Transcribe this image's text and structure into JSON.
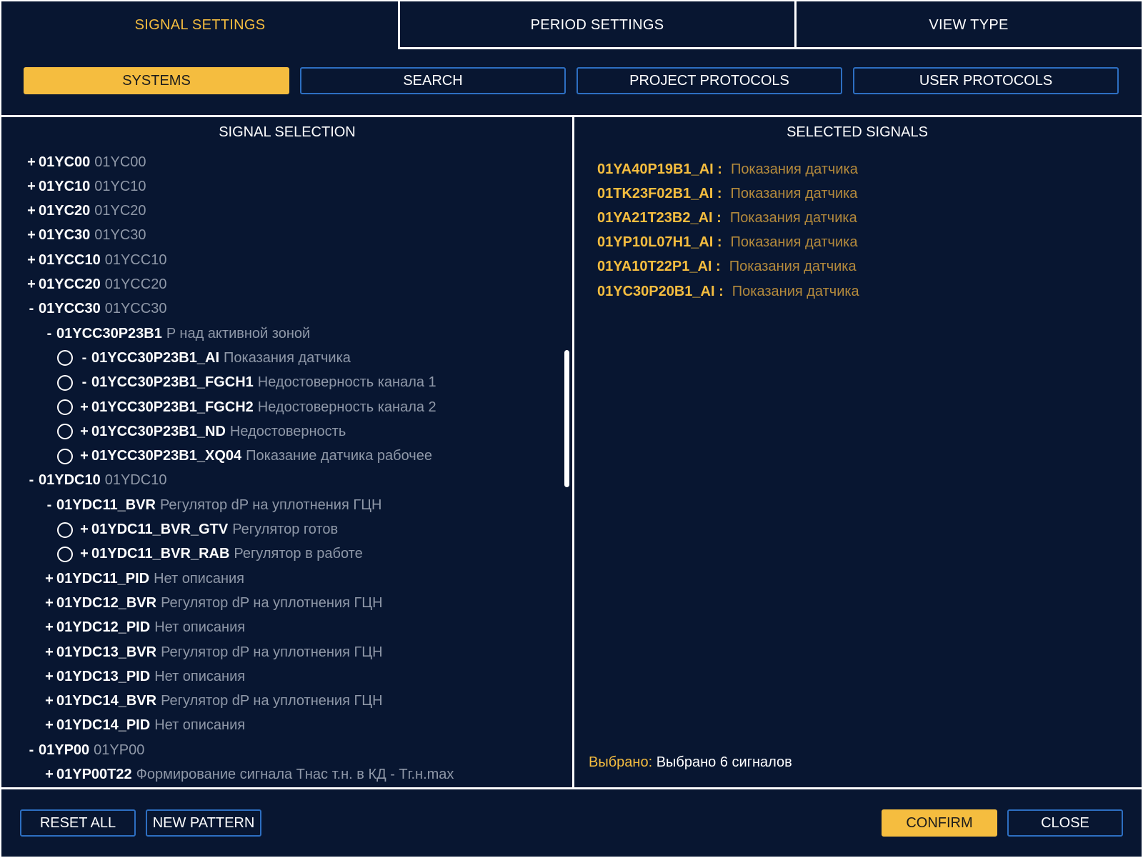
{
  "tabs": [
    {
      "label": "SIGNAL SETTINGS",
      "active": true
    },
    {
      "label": "PERIOD SETTINGS",
      "active": false
    },
    {
      "label": "VIEW TYPE",
      "active": false
    }
  ],
  "subtabs": [
    {
      "label": "SYSTEMS",
      "active": true
    },
    {
      "label": "SEARCH",
      "active": false
    },
    {
      "label": "PROJECT PROTOCOLS",
      "active": false
    },
    {
      "label": "USER PROTOCOLS",
      "active": false
    }
  ],
  "left_panel": {
    "title": "SIGNAL SELECTION",
    "tree": [
      {
        "level": 0,
        "toggle": "+",
        "radio": false,
        "code": "01YC00",
        "desc": "01YC00"
      },
      {
        "level": 0,
        "toggle": "+",
        "radio": false,
        "code": "01YC10",
        "desc": "01YC10"
      },
      {
        "level": 0,
        "toggle": "+",
        "radio": false,
        "code": "01YC20",
        "desc": "01YC20"
      },
      {
        "level": 0,
        "toggle": "+",
        "radio": false,
        "code": "01YC30",
        "desc": "01YC30"
      },
      {
        "level": 0,
        "toggle": "+",
        "radio": false,
        "code": "01YCC10",
        "desc": "01YCC10"
      },
      {
        "level": 0,
        "toggle": "+",
        "radio": false,
        "code": "01YCC20",
        "desc": "01YCC20"
      },
      {
        "level": 0,
        "toggle": "-",
        "radio": false,
        "code": "01YCC30",
        "desc": "01YCC30"
      },
      {
        "level": 1,
        "toggle": "-",
        "radio": false,
        "code": "01YCC30P23B1",
        "desc": "P над активной зоной"
      },
      {
        "level": 2,
        "toggle": "-",
        "radio": true,
        "code": "01YCC30P23B1_AI",
        "desc": "Показания датчика"
      },
      {
        "level": 2,
        "toggle": "-",
        "radio": true,
        "code": "01YCC30P23B1_FGCH1",
        "desc": "Недостоверность канала 1"
      },
      {
        "level": 2,
        "toggle": "+",
        "radio": true,
        "code": "01YCC30P23B1_FGCH2",
        "desc": "Недостоверность канала 2"
      },
      {
        "level": 2,
        "toggle": "+",
        "radio": true,
        "code": "01YCC30P23B1_ND",
        "desc": "Недостоверность"
      },
      {
        "level": 2,
        "toggle": "+",
        "radio": true,
        "code": "01YCC30P23B1_XQ04",
        "desc": "Показание датчика рабочее"
      },
      {
        "level": 0,
        "toggle": "-",
        "radio": false,
        "code": "01YDC10",
        "desc": "01YDC10"
      },
      {
        "level": 1,
        "toggle": "-",
        "radio": false,
        "code": "01YDC11_BVR",
        "desc": "Регулятор dP на уплотнения ГЦН"
      },
      {
        "level": 2,
        "toggle": "+",
        "radio": true,
        "code": "01YDC11_BVR_GTV",
        "desc": "Регулятор готов"
      },
      {
        "level": 2,
        "toggle": "+",
        "radio": true,
        "code": "01YDC11_BVR_RAB",
        "desc": "Регулятор в работе"
      },
      {
        "level": 1,
        "toggle": "+",
        "radio": false,
        "code": "01YDC11_PID",
        "desc": "Нет описания"
      },
      {
        "level": 1,
        "toggle": "+",
        "radio": false,
        "code": "01YDC12_BVR",
        "desc": "Регулятор dP на уплотнения ГЦН"
      },
      {
        "level": 1,
        "toggle": "+",
        "radio": false,
        "code": "01YDC12_PID",
        "desc": "Нет описания"
      },
      {
        "level": 1,
        "toggle": "+",
        "radio": false,
        "code": "01YDC13_BVR",
        "desc": "Регулятор dP на уплотнения ГЦН"
      },
      {
        "level": 1,
        "toggle": "+",
        "radio": false,
        "code": "01YDC13_PID",
        "desc": "Нет описания"
      },
      {
        "level": 1,
        "toggle": "+",
        "radio": false,
        "code": "01YDC14_BVR",
        "desc": "Регулятор dP на уплотнения ГЦН"
      },
      {
        "level": 1,
        "toggle": "+",
        "radio": false,
        "code": "01YDC14_PID",
        "desc": "Нет описания"
      },
      {
        "level": 0,
        "toggle": "-",
        "radio": false,
        "code": "01YP00",
        "desc": "01YP00"
      },
      {
        "level": 1,
        "toggle": "+",
        "radio": false,
        "code": "01YP00T22",
        "desc": "Формирование сигнала Тнас т.н. в КД - Тг.н.max"
      }
    ]
  },
  "right_panel": {
    "title": "SELECTED SIGNALS",
    "signals": [
      {
        "code": "01YA40P19B1_AI :",
        "desc": "Показания датчика"
      },
      {
        "code": "01TK23F02B1_AI :",
        "desc": "Показания датчика"
      },
      {
        "code": "01YA21T23B2_AI :",
        "desc": "Показания датчика"
      },
      {
        "code": "01YP10L07H1_AI :",
        "desc": "Показания датчика"
      },
      {
        "code": "01YA10T22P1_AI :",
        "desc": "Показания датчика"
      },
      {
        "code": "01YC30P20B1_AI :",
        "desc": "Показания датчика"
      }
    ],
    "summary_label": "Выбрано:",
    "summary_value": "Выбрано 6 сигналов"
  },
  "footer": {
    "reset_all": "RESET ALL",
    "new_pattern": "NEW PATTERN",
    "confirm": "CONFIRM",
    "close": "CLOSE"
  },
  "colors": {
    "background": "#081631",
    "accent": "#f5bd3f",
    "button_border": "#2d6fc2",
    "muted_text": "#8f98a8",
    "selected_desc": "#b48a3c"
  }
}
